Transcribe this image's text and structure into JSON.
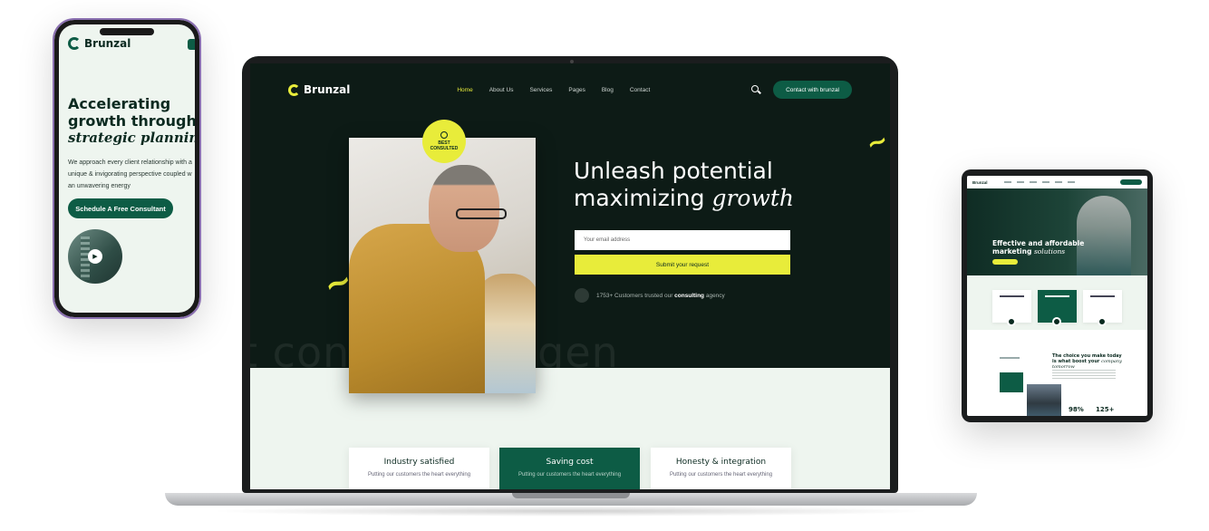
{
  "phone": {
    "brand": "Brunzal",
    "title_line1": "Accelerating",
    "title_line2": "growth through",
    "title_italic": "strategic planning",
    "body_line1": "We approach every client relationship with a",
    "body_line2": "unique & invigorating perspective coupled w",
    "body_line3": "an unwavering energy",
    "cta": "Schedule A Free Consultant",
    "play_icon": "▶"
  },
  "laptop": {
    "brand": "Brunzal",
    "nav": [
      "Home",
      "About Us",
      "Services",
      "Pages",
      "Blog",
      "Contact"
    ],
    "nav_cta": "Contact with brunzal",
    "badge_line1": "BEST",
    "badge_line2": "CONSULTED",
    "headline_line1": "Unleash potential",
    "headline_line2_plain": "maximizing ",
    "headline_line2_italic": "growth",
    "email_placeholder": "Your email address",
    "submit": "Submit your request",
    "trust_prefix": "1753+ Customers trusted our ",
    "trust_bold": "consulting",
    "trust_suffix": " agency",
    "watermark": "t consulting agen",
    "cards": [
      {
        "title": "Industry satisfied",
        "desc": "Putting our customers the heart everything"
      },
      {
        "title": "Saving cost",
        "desc": "Putting our customers the heart everything"
      },
      {
        "title": "Honesty & integration",
        "desc": "Putting our customers the heart everything"
      }
    ],
    "squiggle": "~"
  },
  "tablet": {
    "brand": "Brunzal",
    "headline_line1": "Effective and affordable",
    "headline_line2_plain": "marketing ",
    "headline_line2_italic": "solutions",
    "section_line1": "The choice you make today",
    "section_line2_plain": "is what boost your ",
    "section_line2_italic": "company",
    "section_line3_italic": "tomorrow",
    "stat1": "98%",
    "stat2": "125+"
  },
  "colors": {
    "brand_green": "#0d5c45",
    "accent_yellow": "#e8ec3a",
    "dark_bg": "#0d1b16",
    "light_bg": "#eef5ef"
  }
}
